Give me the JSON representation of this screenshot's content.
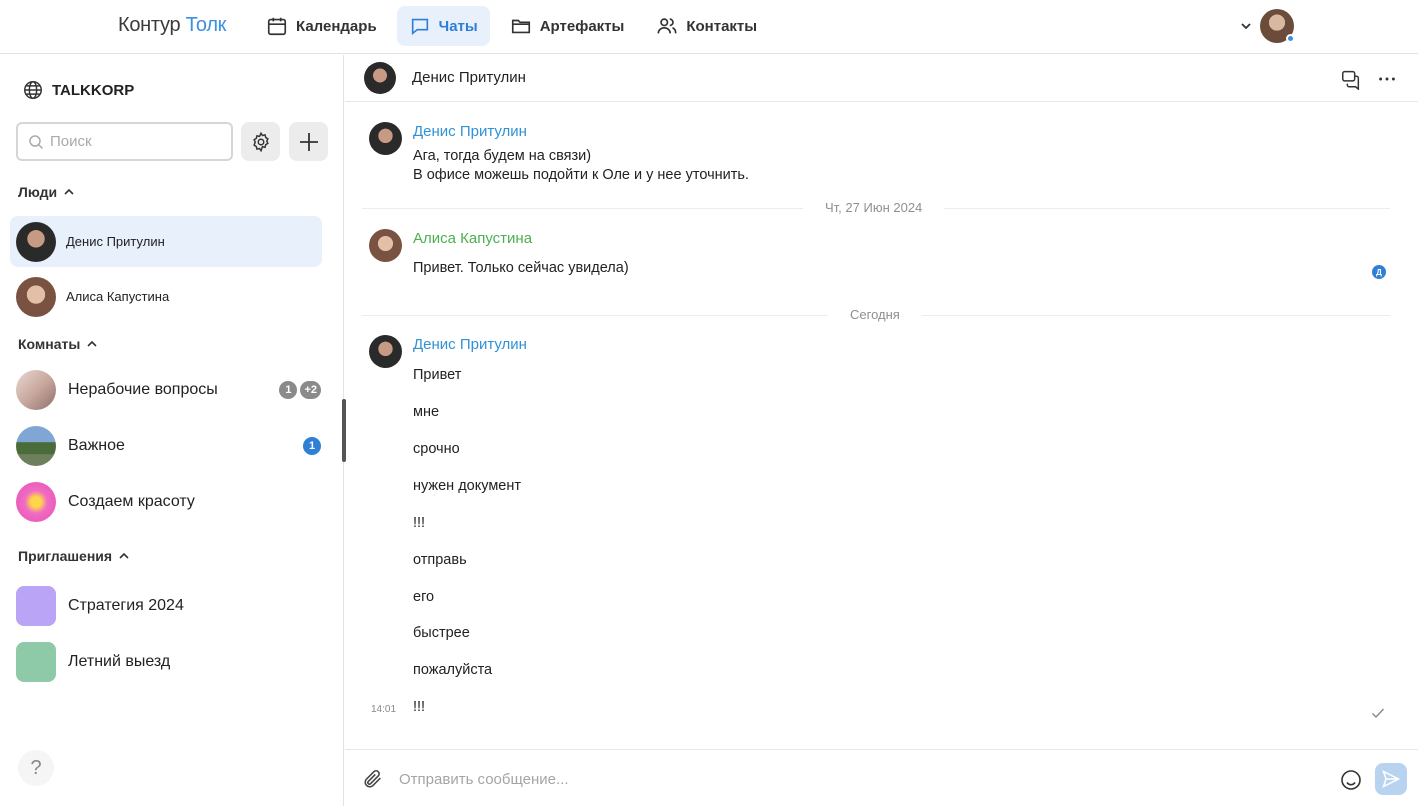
{
  "app": {
    "logo_main": "Контур",
    "logo_accent": "Толк"
  },
  "nav": {
    "items": [
      {
        "label": "Календарь",
        "icon": "calendar-icon"
      },
      {
        "label": "Чаты",
        "icon": "chat-icon",
        "active": true
      },
      {
        "label": "Артефакты",
        "icon": "folder-icon"
      },
      {
        "label": "Контакты",
        "icon": "contacts-icon"
      }
    ]
  },
  "sidebar": {
    "org": "TALKKORP",
    "search_placeholder": "Поиск",
    "sections": {
      "people": "Люди",
      "rooms": "Комнаты",
      "invites": "Приглашения"
    },
    "people": [
      {
        "name": "Денис Притулин",
        "active": true
      },
      {
        "name": "Алиса Капустина"
      }
    ],
    "rooms": [
      {
        "name": "Нерабочие вопросы",
        "badges": [
          "1",
          "+2"
        ]
      },
      {
        "name": "Важное",
        "badges": [
          "1"
        ]
      },
      {
        "name": "Создаем красоту",
        "badges": []
      }
    ],
    "invites": [
      {
        "name": "Стратегия 2024",
        "color": "#b9a4f5"
      },
      {
        "name": "Летний выезд",
        "color": "#8fcaa8"
      }
    ],
    "help": "?"
  },
  "chat": {
    "header_name": "Денис Притулин",
    "messages": [
      {
        "sender": "Денис Притулин",
        "lines": [
          "Ага, тогда будем на связи)",
          "В офисе можешь подойти к Оле и у нее уточнить."
        ]
      },
      {
        "divider": "Чт, 27 Июн 2024"
      },
      {
        "sender": "Алиса Капустина",
        "lines": [
          "Привет. Только сейчас увидела)"
        ],
        "read_badge": "Д"
      },
      {
        "divider": "Сегодня"
      },
      {
        "sender": "Денис Притулин",
        "lines": [
          "Привет",
          "мне",
          "срочно",
          "нужен документ",
          "!!!",
          "отправь",
          "его",
          "быстрее",
          "пожалуйста",
          "!!!"
        ],
        "time": "14:01"
      }
    ],
    "composer_placeholder": "Отправить сообщение..."
  },
  "colors": {
    "accent": "#2f7fd6",
    "sender_blue": "#2f92d6",
    "sender_green": "#4caf50"
  }
}
